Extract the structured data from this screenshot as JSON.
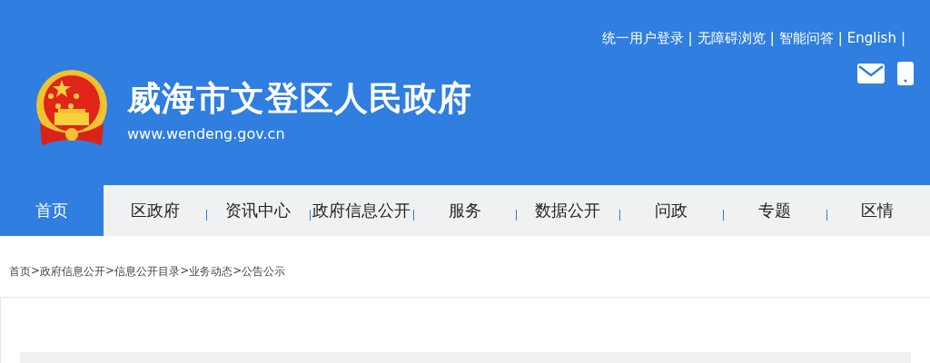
{
  "top_links": {
    "items": [
      "统一用户登录",
      "无障碍浏览",
      "智能问答",
      "English"
    ],
    "separator": "|"
  },
  "site": {
    "title": "威海市文登区人民政府",
    "url": "www.wendeng.gov.cn"
  },
  "nav": [
    {
      "label": "首页",
      "selected": true
    },
    {
      "label": "区政府",
      "selected": false
    },
    {
      "label": "资讯中心",
      "selected": false
    },
    {
      "label": "政府信息公开",
      "selected": false
    },
    {
      "label": "服务",
      "selected": false
    },
    {
      "label": "数据公开",
      "selected": false
    },
    {
      "label": "问政",
      "selected": false
    },
    {
      "label": "专题",
      "selected": false
    },
    {
      "label": "区情",
      "selected": false
    }
  ],
  "breadcrumb": {
    "items": [
      "首页",
      "政府信息公开",
      "信息公开目录",
      "业务动态",
      "公告公示"
    ],
    "separator": ">"
  }
}
